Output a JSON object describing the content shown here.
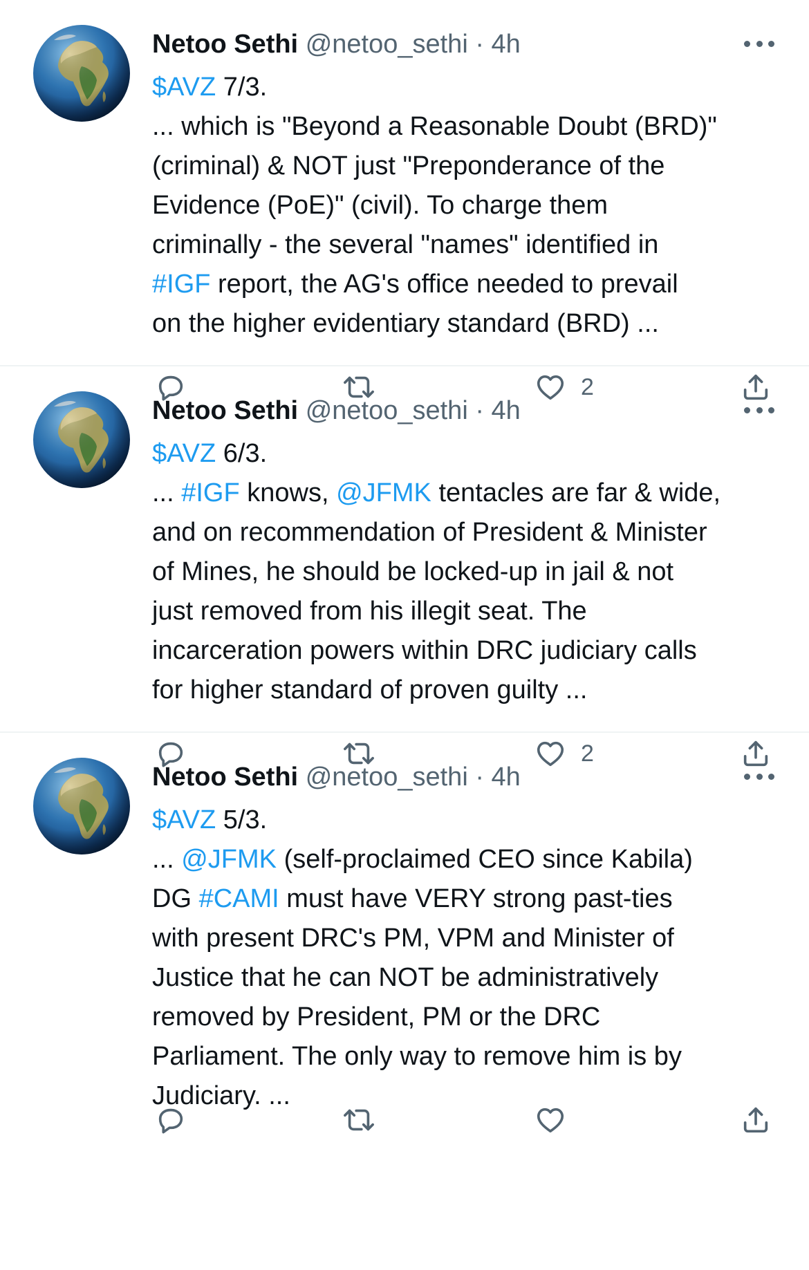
{
  "tweets": [
    {
      "name": "Netoo Sethi",
      "handle": "@netoo_sethi",
      "separator": "·",
      "time": "4h",
      "lines": [
        [
          {
            "t": "$AVZ",
            "link": true
          },
          {
            "t": " 7/3."
          }
        ],
        [
          {
            "t": "... which is \"Beyond a Reasonable Doubt (BRD)\""
          }
        ],
        [
          {
            "t": "(criminal) & NOT just \"Preponderance of the"
          }
        ],
        [
          {
            "t": "Evidence (PoE)\" (civil). To charge them"
          }
        ],
        [
          {
            "t": "criminally - the several \"names\" identified in"
          }
        ],
        [
          {
            "t": "#IGF",
            "link": true
          },
          {
            "t": " report, the AG's office needed to prevail"
          }
        ],
        [
          {
            "t": "on the higher evidentiary standard (BRD) ..."
          }
        ]
      ],
      "likes": "2"
    },
    {
      "name": "Netoo Sethi",
      "handle": "@netoo_sethi",
      "separator": "·",
      "time": "4h",
      "lines": [
        [
          {
            "t": "$AVZ",
            "link": true
          },
          {
            "t": " 6/3."
          }
        ],
        [
          {
            "t": "... "
          },
          {
            "t": "#IGF",
            "link": true
          },
          {
            "t": " knows, "
          },
          {
            "t": "@JFMK",
            "link": true
          },
          {
            "t": " tentacles are far & wide,"
          }
        ],
        [
          {
            "t": "and on recommendation of President & Minister"
          }
        ],
        [
          {
            "t": "of Mines, he should be locked-up in jail & not"
          }
        ],
        [
          {
            "t": "just removed from his illegit seat. The"
          }
        ],
        [
          {
            "t": "incarceration powers within DRC judiciary calls"
          }
        ],
        [
          {
            "t": "for higher standard of proven guilty ..."
          }
        ]
      ],
      "likes": "2"
    },
    {
      "name": "Netoo Sethi",
      "handle": "@netoo_sethi",
      "separator": "·",
      "time": "4h",
      "lines": [
        [
          {
            "t": "$AVZ",
            "link": true
          },
          {
            "t": " 5/3."
          }
        ],
        [
          {
            "t": "... "
          },
          {
            "t": "@JFMK",
            "link": true
          },
          {
            "t": " (self-proclaimed CEO since Kabila)"
          }
        ],
        [
          {
            "t": "DG "
          },
          {
            "t": "#CAMI",
            "link": true
          },
          {
            "t": " must have VERY strong past-ties"
          }
        ],
        [
          {
            "t": "with present DRC's PM, VPM and Minister of"
          }
        ],
        [
          {
            "t": "Justice that he can NOT be administratively"
          }
        ],
        [
          {
            "t": "removed by President, PM or the DRC"
          }
        ],
        [
          {
            "t": "Parliament. The only way to remove him is by"
          }
        ],
        [
          {
            "t": "Judiciary. ..."
          }
        ]
      ],
      "likes": ""
    }
  ],
  "icons": {
    "avatar": "globe-africa-icon",
    "reply": "reply-icon",
    "retweet": "retweet-icon",
    "like": "heart-icon",
    "share": "share-icon",
    "more": "more-icon"
  },
  "colors": {
    "link": "#1d9bf0",
    "secondary": "#536471",
    "text": "#0f1419",
    "divider": "#eff3f4"
  }
}
